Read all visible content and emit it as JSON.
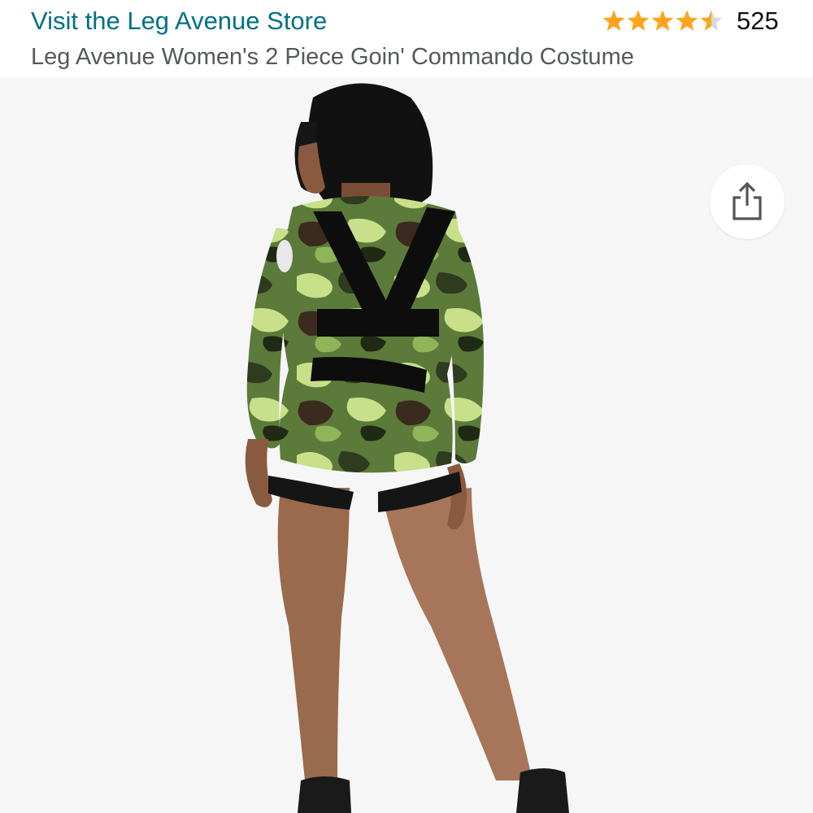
{
  "header": {
    "store_link": "Visit the Leg Avenue Store",
    "rating_value": 4.5,
    "rating_count": "525",
    "product_title": "Leg Avenue Women's 2 Piece Goin' Commando Costume"
  },
  "icons": {
    "star": "star-icon",
    "share": "share-icon"
  },
  "colors": {
    "link": "#007185",
    "star": "#ffa41c",
    "star_empty": "#d5d9d9",
    "title": "#565959",
    "image_bg": "#f6f6f6"
  }
}
